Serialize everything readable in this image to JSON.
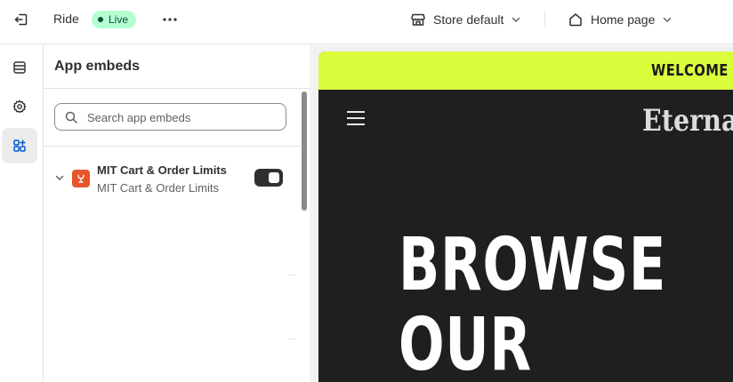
{
  "topbar": {
    "theme_name": "Ride",
    "status_badge": "Live",
    "store_selector": "Store default",
    "page_selector": "Home page"
  },
  "rail": {
    "items": [
      {
        "icon": "sections-icon",
        "active": false
      },
      {
        "icon": "gear-icon",
        "active": false
      },
      {
        "icon": "app-embeds-icon",
        "active": true
      }
    ]
  },
  "panel": {
    "title": "App embeds",
    "search": {
      "placeholder": "Search app embeds",
      "value": ""
    },
    "embeds": [
      {
        "title": "MIT Cart & Order Limits",
        "subtitle": "MIT Cart & Order Limits",
        "enabled": true
      }
    ]
  },
  "preview": {
    "announcement": "WELCOME TO",
    "logo": "Eternal",
    "hero_line_1": "BROWSE",
    "hero_line_2": "OUR"
  },
  "colors": {
    "announcement_bg": "#dafe3c",
    "live_badge_bg": "#b4fed2",
    "app_icon_bg": "#e8542b",
    "preview_bg": "#1f1f1f"
  }
}
